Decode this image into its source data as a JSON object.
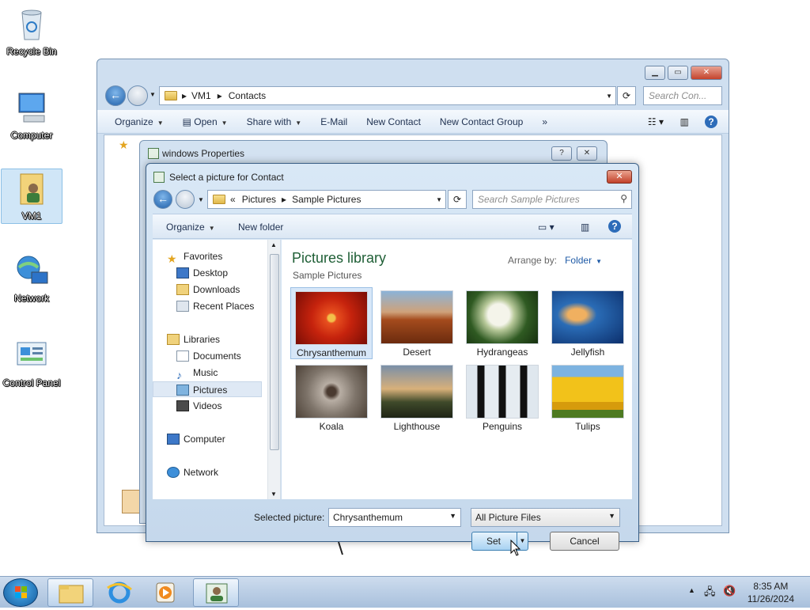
{
  "desktop": {
    "icons": [
      {
        "label": "Recycle Bin"
      },
      {
        "label": "Computer"
      },
      {
        "label": "VM1"
      },
      {
        "label": "Network"
      },
      {
        "label": "Control Panel"
      }
    ]
  },
  "explorer": {
    "breadcrumb": [
      "VM1",
      "Contacts"
    ],
    "search_placeholder": "Search Con...",
    "commands": {
      "organize": "Organize",
      "open": "Open",
      "share_with": "Share with",
      "email": "E-Mail",
      "new_contact": "New Contact",
      "new_contact_group": "New Contact Group",
      "more": "»"
    }
  },
  "properties": {
    "title": "windows Properties",
    "help": "?",
    "close": "✕"
  },
  "dialog": {
    "title": "Select a picture for Contact",
    "close": "✕",
    "breadcrumb_prefix": "«",
    "breadcrumb": [
      "Pictures",
      "Sample Pictures"
    ],
    "search_placeholder": "Search Sample Pictures",
    "toolbar": {
      "organize": "Organize",
      "new_folder": "New folder"
    },
    "nav": {
      "favorites": "Favorites",
      "desktop": "Desktop",
      "downloads": "Downloads",
      "recent_places": "Recent Places",
      "libraries": "Libraries",
      "documents": "Documents",
      "music": "Music",
      "pictures": "Pictures",
      "videos": "Videos",
      "computer": "Computer",
      "network": "Network"
    },
    "library_title": "Pictures library",
    "library_subtitle": "Sample Pictures",
    "arrange_label": "Arrange by:",
    "arrange_value": "Folder",
    "thumbnails": [
      {
        "label": "Chrysanthemum"
      },
      {
        "label": "Desert"
      },
      {
        "label": "Hydrangeas"
      },
      {
        "label": "Jellyfish"
      },
      {
        "label": "Koala"
      },
      {
        "label": "Lighthouse"
      },
      {
        "label": "Penguins"
      },
      {
        "label": "Tulips"
      }
    ],
    "selected_label": "Selected picture:",
    "selected_value": "Chrysanthemum",
    "filter_value": "All Picture Files",
    "set_button": "Set",
    "cancel_button": "Cancel"
  },
  "taskbar": {
    "time": "8:35 AM",
    "date": "11/26/2024"
  }
}
